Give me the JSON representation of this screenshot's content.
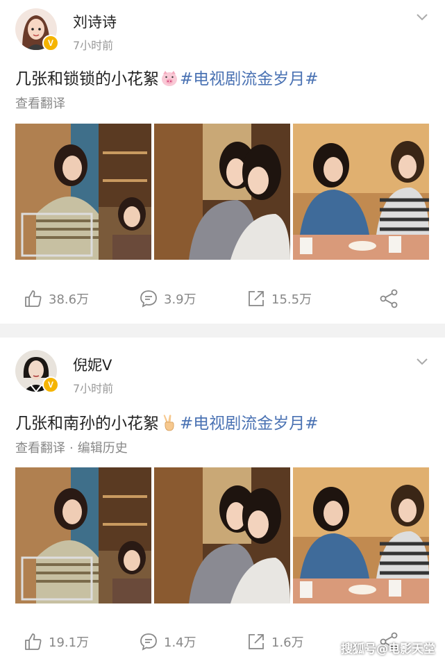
{
  "posts": [
    {
      "username": "刘诗诗",
      "time": "7小时前",
      "text_before": "几张和锁锁的小花絮",
      "emoji": "pig-face-emoji",
      "hashtag": "#电视剧流金岁月#",
      "meta_links": [
        "查看翻译"
      ],
      "stats": {
        "likes": "38.6万",
        "comments": "3.9万",
        "reposts": "15.5万"
      }
    },
    {
      "username": "倪妮V",
      "time": "7小时前",
      "text_before": "几张和南孙的小花絮",
      "emoji": "victory-hand-emoji",
      "hashtag": "#电视剧流金岁月#",
      "meta_links": [
        "查看翻译",
        "编辑历史"
      ],
      "meta_separator": "·",
      "stats": {
        "likes": "19.1万",
        "comments": "1.4万",
        "reposts": "1.6万"
      }
    }
  ],
  "watermark": "搜狐号@电影天堂",
  "colors": {
    "hashtag": "#4a72b3",
    "verified_badge": "#f5b400",
    "separator": "#f2f2f2"
  }
}
